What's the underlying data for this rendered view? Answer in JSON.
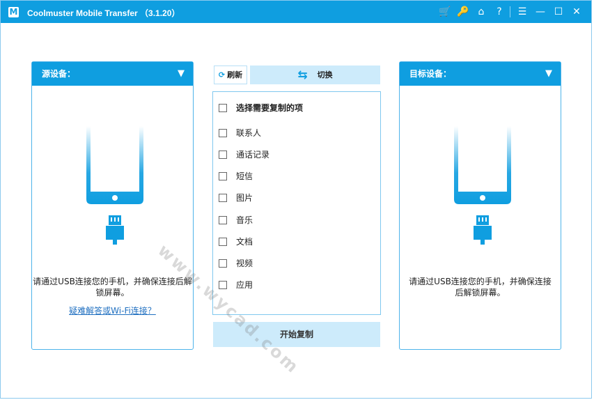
{
  "app": {
    "logo_letter": "M",
    "title": "Coolmuster Mobile Transfer （3.1.20）",
    "toolbar_icons": [
      "cart-icon",
      "key-icon",
      "home-icon",
      "help-icon",
      "feedback-icon",
      "minimize-icon",
      "maximize-icon",
      "close-icon"
    ]
  },
  "source": {
    "label": "源设备：",
    "instruction": "请通过USB连接您的手机，并确保连接后解锁屏幕。",
    "help_link": "疑难解答或Wi-Fi连接？"
  },
  "target": {
    "label": "目标设备：",
    "instruction": "请通过USB连接您的手机，并确保连接后解锁屏幕。"
  },
  "controls": {
    "refresh": "刷新",
    "switch": "切换",
    "start_copy": "开始复制"
  },
  "content_list": {
    "header": "选择需要复制的项",
    "items": [
      "联系人",
      "通话记录",
      "短信",
      "图片",
      "音乐",
      "文档",
      "视频",
      "应用"
    ]
  },
  "watermark": "www.wycad.com",
  "colors": {
    "accent": "#0f9ee0",
    "light_accent": "#cdebfb",
    "link": "#1f6fc0"
  }
}
